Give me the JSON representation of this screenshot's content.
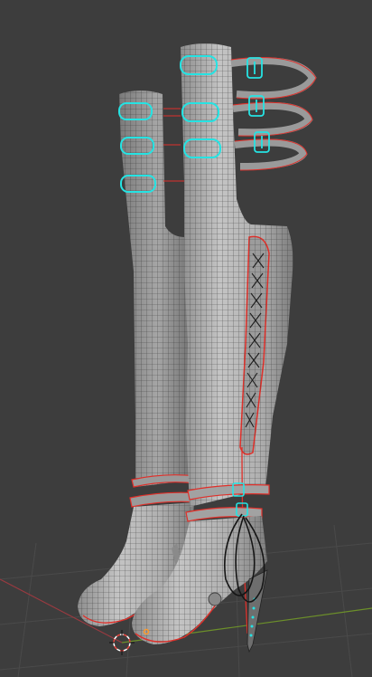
{
  "viewport": {
    "background": "#3d3d3d",
    "grid_color": "#4a4a4a",
    "x_axis_color": "#9b3a40",
    "y_axis_color": "#6c8f2a"
  },
  "model": {
    "name": "thigh-high-lace-up-boots",
    "mesh_color": "#b7b7b7",
    "wire_color": "#2b2b2b",
    "seam_color": "#e0302a",
    "selected_edge_color": "#25e3e3",
    "lace_color": "#151515"
  },
  "cursor_3d": {
    "icon": "3d-cursor-icon",
    "ring_color": "#e8463f",
    "ring_alt_color": "#ffffff"
  },
  "origin": {
    "icon": "object-origin-icon",
    "color": "#ff9a2a"
  }
}
